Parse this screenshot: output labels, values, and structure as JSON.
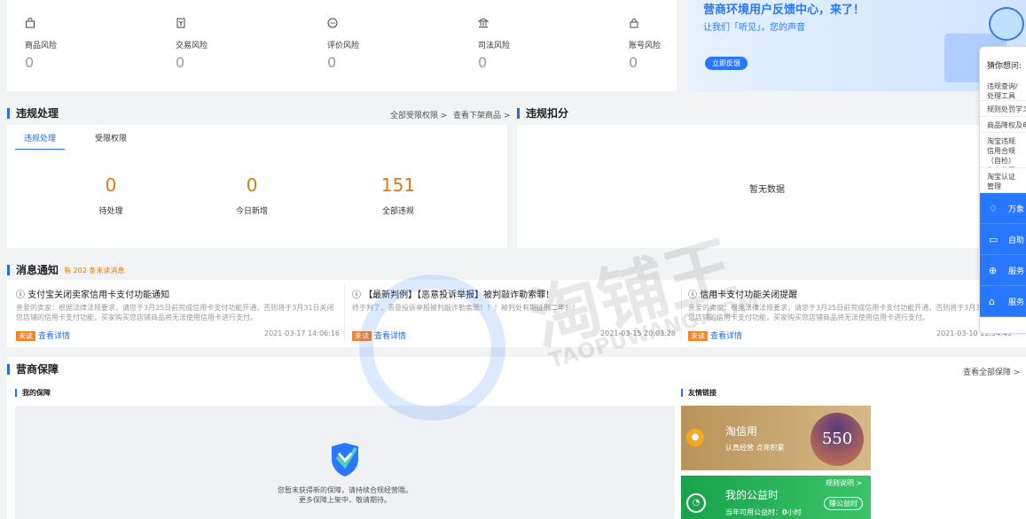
{
  "risk": {
    "items": [
      {
        "icon": "bag-icon",
        "label": "商品风险",
        "value": "0"
      },
      {
        "icon": "trade-doc-icon",
        "label": "交易风险",
        "value": "0"
      },
      {
        "icon": "comment-icon",
        "label": "评价风险",
        "value": "0"
      },
      {
        "icon": "court-icon",
        "label": "司法风险",
        "value": "0"
      },
      {
        "icon": "lock-icon",
        "label": "账号风险",
        "value": "0"
      }
    ]
  },
  "banner": {
    "title": "营商环境用户反馈中心，来了！",
    "subtitle": "让我们「听见」，您的声音",
    "button": "立即反馈"
  },
  "violation": {
    "title": "违规处理",
    "link_all_limits": "全部受限权限 >",
    "link_delisted": "查看下架商品 >",
    "tabs": [
      "违规处理",
      "受限权限"
    ],
    "stats": [
      {
        "value": "0",
        "label": "待处理"
      },
      {
        "value": "0",
        "label": "今日新增"
      },
      {
        "value": "151",
        "label": "全部违规"
      }
    ]
  },
  "deduction": {
    "title": "违规扣分",
    "empty": "暂无数据"
  },
  "messages": {
    "title": "消息通知",
    "unread": "有 202 条未读消息",
    "items": [
      {
        "title": "支付宝关闭卖家信用卡支付功能通知",
        "body": "亲爱的卖家：根据法律法规要求，请您于3月25日前完成信用卡支付功能开通，否则将于3月31日关闭您店铺的信用卡支付功能，买家购买您店铺商品将无法使用信用卡进行支付。",
        "tag": "未读",
        "detail": "查看详情",
        "time": "2021-03-17 14:06:16"
      },
      {
        "title": "【最新判例】【恶意投诉举报】被判敲诈勒索罪！",
        "body": "终于判了，恶意投诉举报被判敲诈勒索罪！！！被判处有期徒刑二年！！",
        "tag": "未读",
        "detail": "查看详情",
        "time": "2021-03-15 20:03:28"
      },
      {
        "title": "信用卡支付功能关闭提醒",
        "body": "亲爱的卖家：根据法律法规要求，请您于3月25日前完成信用卡支付功能开通，否则将于3月31日关闭您店铺的信用卡支付功能，买家购买您店铺商品将无法使用信用卡进行支付。",
        "tag": "未读",
        "detail": "查看详情",
        "time": "2021-03-10 11:54:49"
      }
    ]
  },
  "guarantee": {
    "title": "营商保障",
    "link_all": "查看全部保障 >",
    "mine_title": "我的保障",
    "empty_line1": "您暂未获得新的保障，请持续合规经营哦。",
    "empty_line2": "更多保障上架中，敬请期待。",
    "links_title": "友情链接",
    "credit": {
      "name": "淘信用",
      "sub": "认真经营 点亮积累",
      "score": "550"
    },
    "charity": {
      "name": "我的公益时",
      "rule": "规则说明 >",
      "button": "赚公益时",
      "points_prefix": "当年可用公益时：",
      "points": "0",
      "points_suffix": "小时"
    }
  },
  "feedback": {
    "guess": "猜你想问:",
    "questions": [
      "违规查询/处理工具",
      "规则处罚学习",
      "商品降权及申诉",
      "淘宝违规信用合规（自检）怎么使用",
      "淘宝认证管理"
    ],
    "buttons": [
      {
        "icon": "bell-icon",
        "label": "万象"
      },
      {
        "icon": "chat-icon",
        "label": "自助"
      },
      {
        "icon": "service-icon",
        "label": "服务"
      },
      {
        "icon": "home-icon",
        "label": "服务"
      }
    ]
  },
  "watermark": {
    "main": "淘铺王",
    "sub": "TAOPUWANG.COM"
  },
  "colors": {
    "accent": "#1f6fe5",
    "orange": "#e07a12",
    "tag": "#f5821f",
    "panel_blue": "#2878ff"
  }
}
